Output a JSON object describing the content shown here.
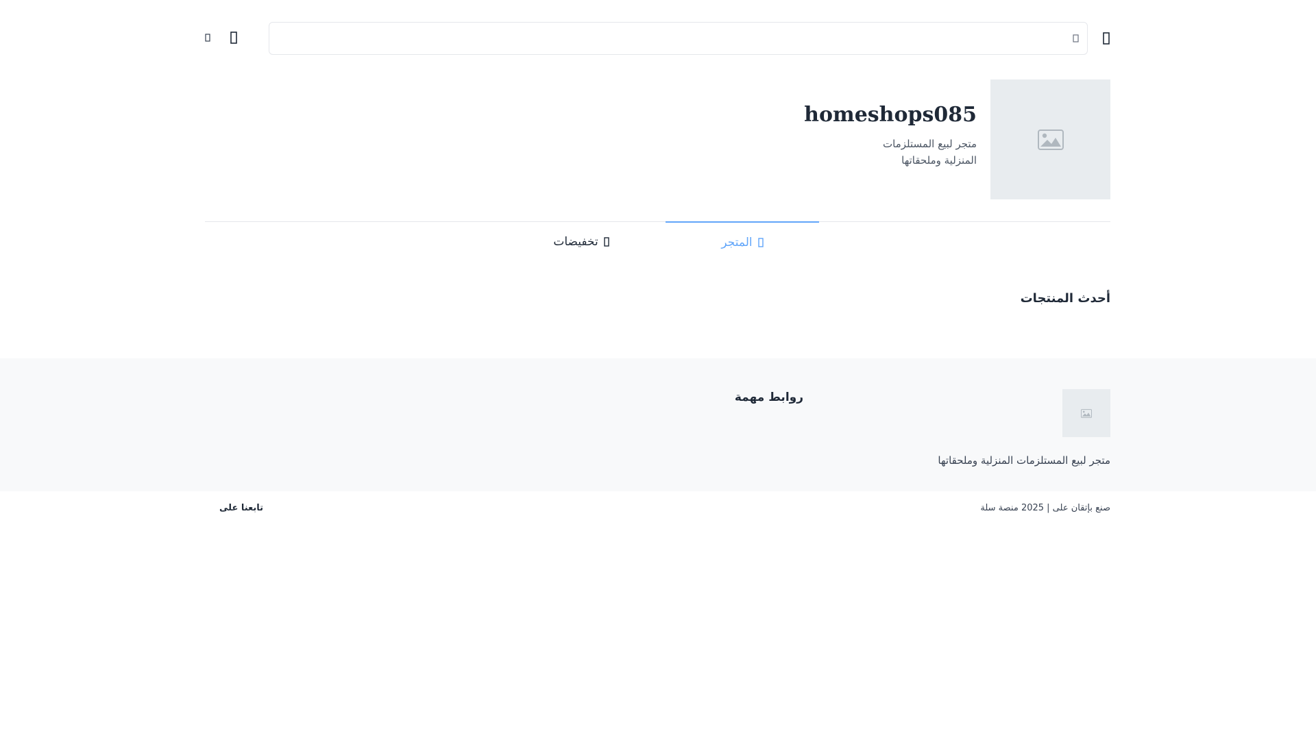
{
  "header": {
    "search_placeholder": "",
    "icons": {
      "menu": "menu-icon",
      "search": "search-icon",
      "user": "user-icon",
      "cart": "cart-icon"
    }
  },
  "store": {
    "name": "homeshops085",
    "description": "متجر لبيع المستلزمات المنزلية وملحقاتها",
    "logo_icon": "image-placeholder-icon"
  },
  "tabs": [
    {
      "label": "المتجر",
      "icon": "store-icon",
      "active": true
    },
    {
      "label": "تخفيضات",
      "icon": "discount-icon",
      "active": false
    }
  ],
  "sections": {
    "latest_products_title": "أحدث المنتجات"
  },
  "footer": {
    "description": "متجر لبيع المستلزمات المنزلية وملحقاتها",
    "links_title": "روابط مهمة",
    "copyright": "صنع بإتقان على | 2025 منصة سلة",
    "follow_us": "تابعنا على"
  },
  "colors": {
    "accent": "#60a5fa",
    "placeholder_bg": "#e8ecef",
    "footer_bg": "#f8f9fa",
    "text": "#1f2937"
  }
}
